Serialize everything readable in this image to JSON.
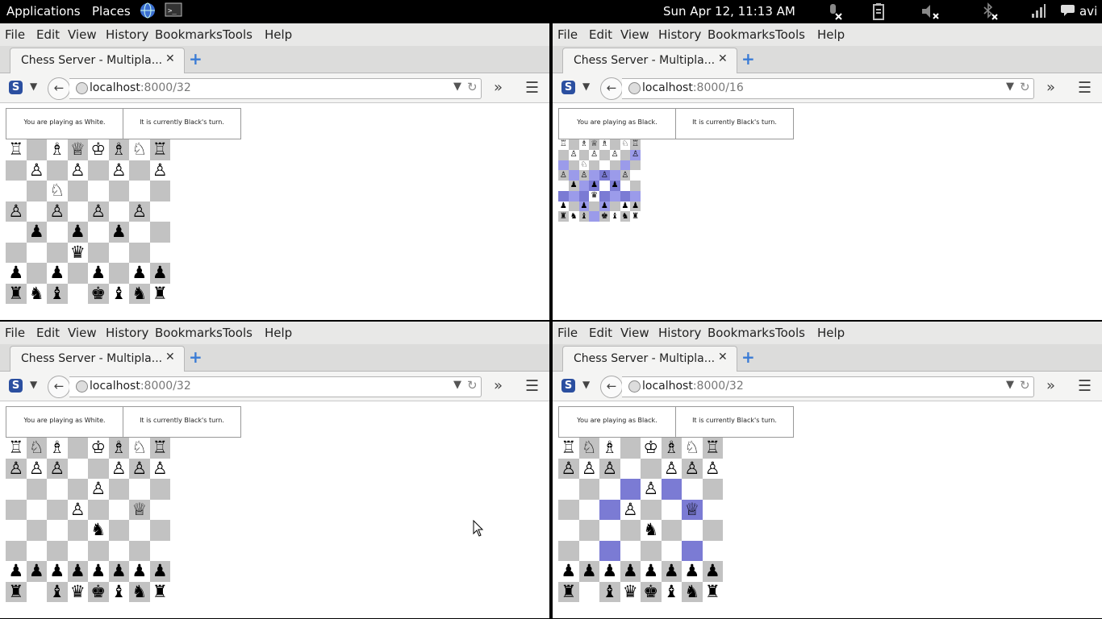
{
  "panel": {
    "applications": "Applications",
    "places": "Places",
    "clock": "Sun Apr 12, 11:13 AM",
    "user": "avi"
  },
  "menu": [
    "File",
    "Edit",
    "View",
    "History",
    "Bookmarks",
    "Tools",
    "Help"
  ],
  "windows": [
    {
      "tab_title": "Chess Server - Multipla...",
      "url_host": "localhost",
      "url_path": ":8000/32",
      "status_player": "You are playing as White.",
      "status_turn": "It is currently Black's turn.",
      "board_size": "large",
      "board": [
        "RxBQKBNR",
        "xPxPxPxP",
        "xxNxxxxx",
        "PxPxPxPx",
        "xpxpxpxx",
        "xxxqxxxx",
        "pxpxpxpp",
        "rnbxkbnr"
      ],
      "highlights": []
    },
    {
      "tab_title": "Chess Server - Multipla...",
      "url_host": "localhost",
      "url_path": ":8000/16",
      "status_player": "You are playing as Black.",
      "status_turn": "It is currently Black's turn.",
      "board_size": "small",
      "board": [
        "RxBQBxNR",
        "xPxPxPxP",
        "xxNxxxxx",
        "PxPxPxPx",
        "xpxpxpxx",
        "xxxqxxxx",
        "pxpxpxpp",
        "rnbxkbnr"
      ],
      "highlights": [
        "1,7",
        "2,0",
        "2,6",
        "3,1",
        "3,3",
        "3,4",
        "3,5",
        "4,2",
        "4,3",
        "4,5",
        "5,0",
        "5,1",
        "5,2",
        "5,4",
        "5,5",
        "5,6",
        "5,7",
        "6,2",
        "6,4",
        "7,3"
      ]
    },
    {
      "tab_title": "Chess Server - Multipla...",
      "url_host": "localhost",
      "url_path": ":8000/32",
      "status_player": "You are playing as White.",
      "status_turn": "It is currently Black's turn.",
      "board_size": "large",
      "board": [
        "RNBxKBNR",
        "PPPxxPPP",
        "xxxxPxxx",
        "xxxPxxQx",
        "xxxxnxxx",
        "xxxxxxxx",
        "pppppppp",
        "rxbqkbnr"
      ],
      "highlights": []
    },
    {
      "tab_title": "Chess Server - Multipla...",
      "url_host": "localhost",
      "url_path": ":8000/32",
      "status_player": "You are playing as Black.",
      "status_turn": "It is currently Black's turn.",
      "board_size": "large",
      "board": [
        "RNBxKBNR",
        "PPPxxPPP",
        "xxxxPxxx",
        "xxxPxxQx",
        "xxxxnxxx",
        "xxxxxxxx",
        "pppppppp",
        "rxbqkbnr"
      ],
      "highlights": [
        "2,3",
        "2,5",
        "3,2",
        "3,6",
        "5,2",
        "5,6"
      ]
    }
  ],
  "colors": {
    "light_square": "#ffffff",
    "dark_square": "#c2c2c2",
    "highlight": "#9b9bea",
    "highlight_dark": "#7b7bd4"
  },
  "glyphs": {
    "K": "♔",
    "Q": "♕",
    "R": "♖",
    "B": "♗",
    "N": "♘",
    "P": "♙",
    "k": "♚",
    "q": "♛",
    "r": "♜",
    "b": "♝",
    "n": "♞",
    "p": "♟"
  },
  "icons": [
    "globe-icon",
    "terminal-icon",
    "mic-muted-icon",
    "battery-icon",
    "volume-muted-icon",
    "bluetooth-off-icon",
    "network-signal-icon",
    "chat-icon"
  ]
}
